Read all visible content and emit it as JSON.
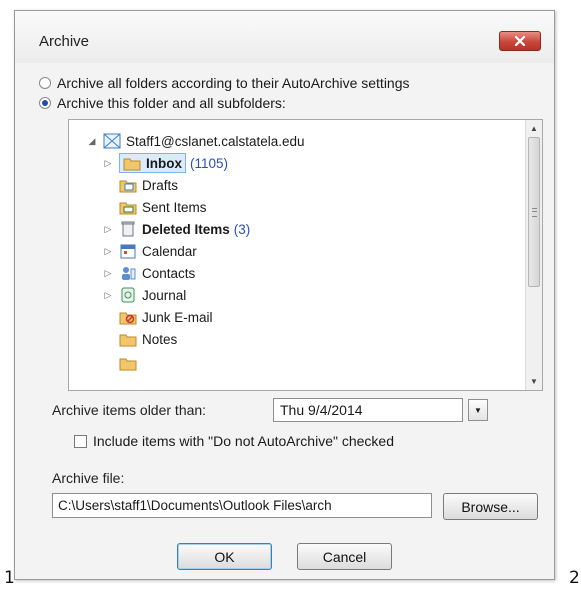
{
  "dialog": {
    "title": "Archive",
    "radio_all_label": "Archive all folders according to their AutoArchive settings",
    "radio_this_label": "Archive this folder and all subfolders:",
    "selected_radio": "this"
  },
  "tree": {
    "account": "Staff1@cslanet.calstatela.edu",
    "items": [
      {
        "label": "Inbox",
        "count": "(1105)",
        "bold": true,
        "expandable": true,
        "selected": true,
        "icon": "inbox-folder-icon"
      },
      {
        "label": "Drafts",
        "count": "",
        "bold": false,
        "expandable": false,
        "selected": false,
        "icon": "drafts-folder-icon"
      },
      {
        "label": "Sent Items",
        "count": "",
        "bold": false,
        "expandable": false,
        "selected": false,
        "icon": "sent-items-folder-icon"
      },
      {
        "label": "Deleted Items",
        "count": "(3)",
        "bold": true,
        "expandable": true,
        "selected": false,
        "icon": "deleted-items-icon"
      },
      {
        "label": "Calendar",
        "count": "",
        "bold": false,
        "expandable": true,
        "selected": false,
        "icon": "calendar-icon"
      },
      {
        "label": "Contacts",
        "count": "",
        "bold": false,
        "expandable": true,
        "selected": false,
        "icon": "contacts-icon"
      },
      {
        "label": "Journal",
        "count": "",
        "bold": false,
        "expandable": true,
        "selected": false,
        "icon": "journal-icon"
      },
      {
        "label": "Junk E-mail",
        "count": "",
        "bold": false,
        "expandable": false,
        "selected": false,
        "icon": "junk-email-icon"
      },
      {
        "label": "Notes",
        "count": "",
        "bold": false,
        "expandable": false,
        "selected": false,
        "icon": "notes-icon"
      }
    ]
  },
  "older_than": {
    "label": "Archive items older than:",
    "value": "Thu 9/4/2014"
  },
  "include_checkbox": {
    "label": "Include items with \"Do not AutoArchive\" checked",
    "checked": false
  },
  "archive_file": {
    "label": "Archive file:",
    "value": "C:\\Users\\staff1\\Documents\\Outlook Files\\arch",
    "browse_label": "Browse..."
  },
  "buttons": {
    "ok_label": "OK",
    "cancel_label": "Cancel"
  },
  "corner_labels": {
    "left": "1",
    "right": "2"
  },
  "colors": {
    "close_button": "#c9463a",
    "unread_count": "#2a4fb8",
    "selection": "#dcebfc"
  }
}
